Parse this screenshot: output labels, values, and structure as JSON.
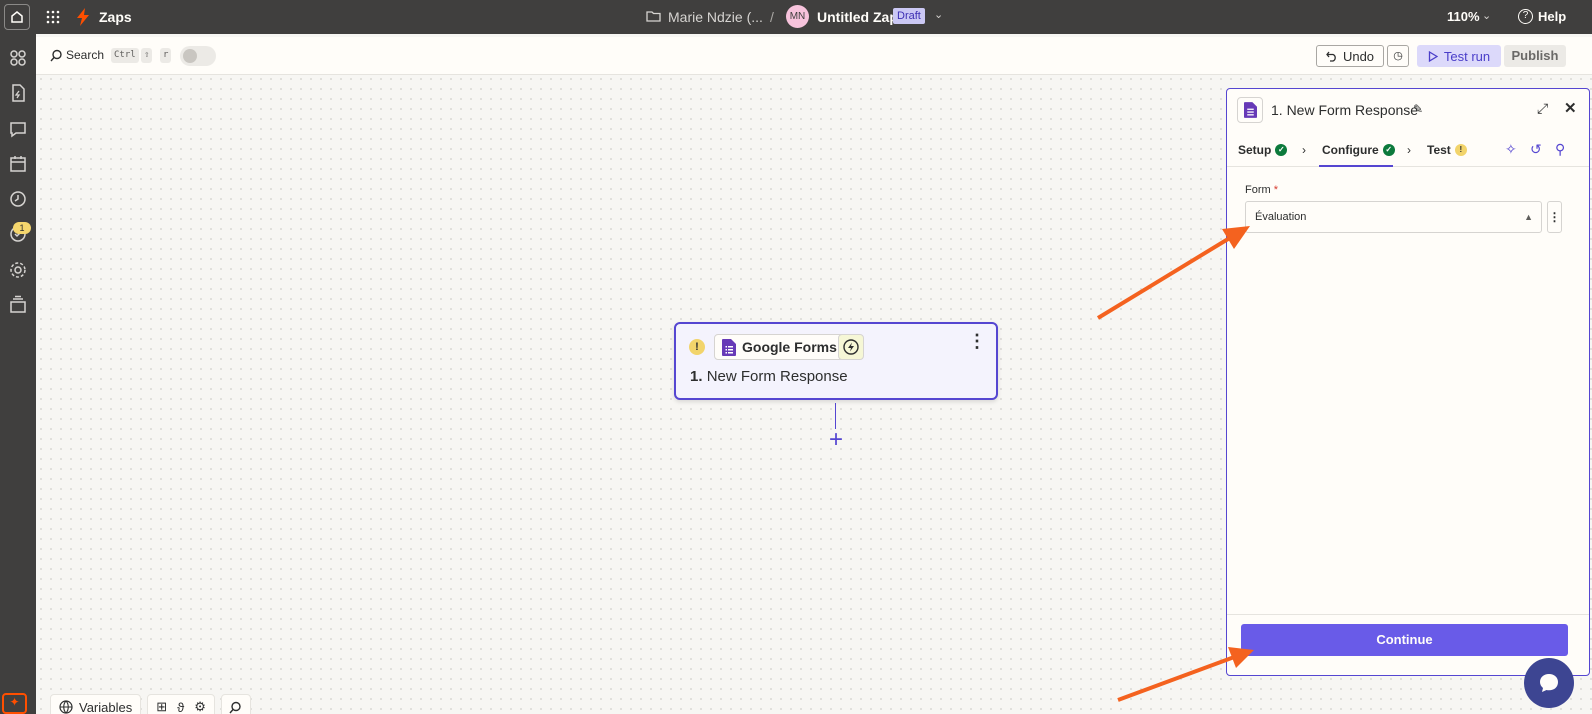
{
  "topbar": {
    "app_title": "Zaps",
    "folder_path": "Marie Ndzie (...",
    "separator": "/",
    "avatar_initials": "MN",
    "zap_name": "Untitled Zap",
    "status_badge": "Draft",
    "zoom": "110%",
    "help_label": "Help"
  },
  "left_rail": {
    "notification_count": "1",
    "icons": [
      "apps-icon",
      "zap-file-icon",
      "chat-icon",
      "calendar-icon",
      "history-icon",
      "status-icon",
      "settings-icon",
      "versions-icon"
    ]
  },
  "toolbar": {
    "search_label": "Search",
    "shortcut_keys": [
      "Ctrl",
      "⇧",
      "r"
    ],
    "undo_label": "Undo",
    "test_run_label": "Test run",
    "publish_label": "Publish"
  },
  "step_node": {
    "app_name": "Google Forms",
    "step_number": "1.",
    "step_title": "New Form Response"
  },
  "panel": {
    "title": "1. New Form Response",
    "tabs": [
      {
        "label": "Setup",
        "status": "complete"
      },
      {
        "label": "Configure",
        "status": "complete"
      },
      {
        "label": "Test",
        "status": "warning"
      }
    ],
    "field": {
      "label": "Form",
      "required_mark": "*",
      "value": "Évaluation"
    },
    "continue_label": "Continue"
  },
  "bottom_bar": {
    "variables_label": "Variables"
  },
  "colors": {
    "brand_orange": "#ff4f00",
    "accent_purple": "#695be8",
    "topbar_bg": "#403f3e",
    "success_green": "#0c7a3c",
    "warning_yellow": "#f2d46b"
  }
}
